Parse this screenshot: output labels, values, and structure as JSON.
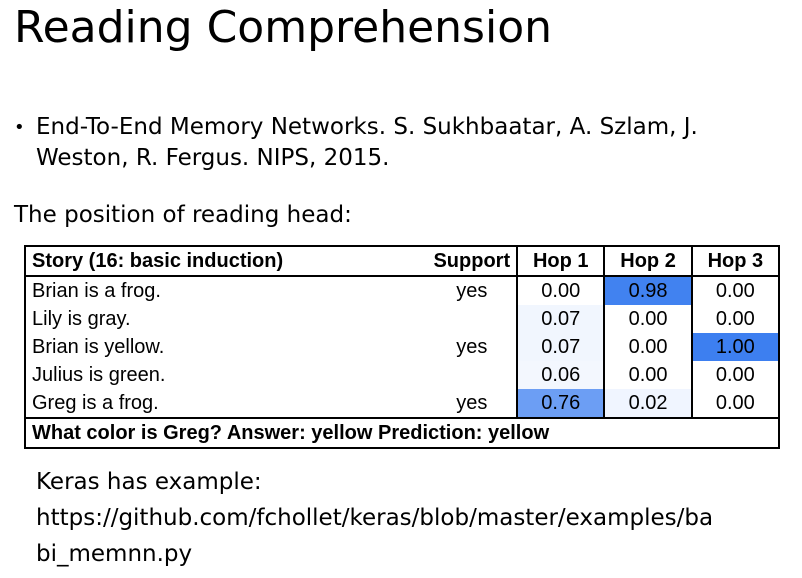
{
  "slide": {
    "title": "Reading Comprehension",
    "bullet_text": "End-To-End Memory Networks. S. Sukhbaatar, A. Szlam, J. Weston, R. Fergus. NIPS, 2015.",
    "subheading": "The position of reading head:",
    "keras_lines": [
      "Keras has example:",
      "https://github.com/fchollet/keras/blob/master/examples/ba",
      "bi_memnn.py"
    ]
  },
  "table": {
    "headers": [
      "Story (16: basic induction)",
      "Support",
      "Hop 1",
      "Hop 2",
      "Hop 3"
    ],
    "rows": [
      {
        "story": "Brian is a frog.",
        "support": "yes",
        "hops": [
          "0.00",
          "0.98",
          "0.00"
        ]
      },
      {
        "story": "Lily is gray.",
        "support": "",
        "hops": [
          "0.07",
          "0.00",
          "0.00"
        ]
      },
      {
        "story": "Brian is yellow.",
        "support": "yes",
        "hops": [
          "0.07",
          "0.00",
          "1.00"
        ]
      },
      {
        "story": "Julius is green.",
        "support": "",
        "hops": [
          "0.06",
          "0.00",
          "0.00"
        ]
      },
      {
        "story": "Greg is a frog.",
        "support": "yes",
        "hops": [
          "0.76",
          "0.02",
          "0.00"
        ]
      }
    ],
    "footer": "What color is Greg?  Answer: yellow    Prediction: yellow",
    "highlight_color": "#3d7ff0"
  }
}
